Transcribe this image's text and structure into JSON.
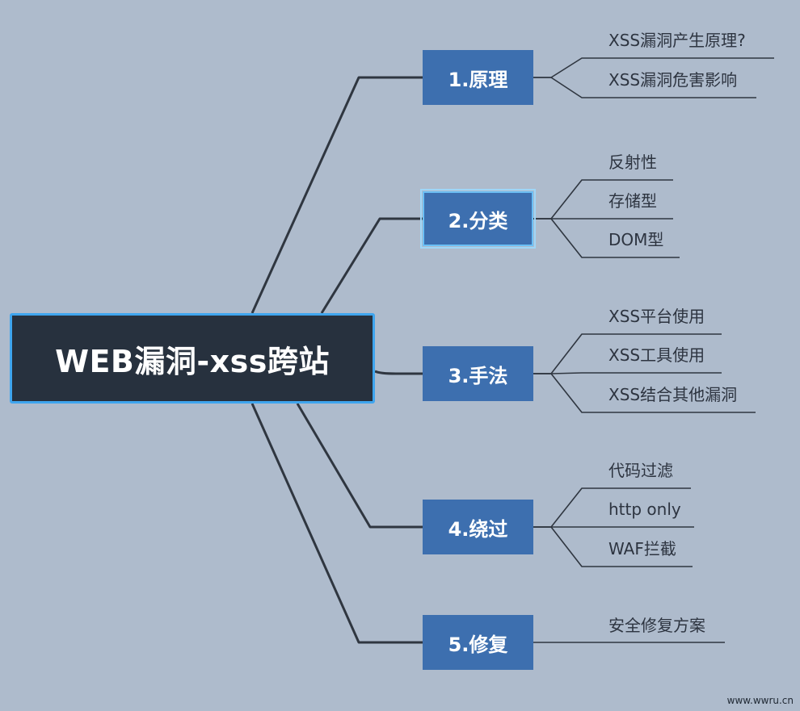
{
  "mindmap": {
    "root": "WEB漏洞-xss跨站",
    "branches": [
      {
        "label": "1.原理",
        "selected": false,
        "children": [
          "XSS漏洞产生原理?",
          "XSS漏洞危害影响"
        ]
      },
      {
        "label": "2.分类",
        "selected": true,
        "children": [
          "反射性",
          "存储型",
          "DOM型"
        ]
      },
      {
        "label": "3.手法",
        "selected": false,
        "children": [
          "XSS平台使用",
          "XSS工具使用",
          "XSS结合其他漏洞"
        ]
      },
      {
        "label": "4.绕过",
        "selected": false,
        "children": [
          "代码过滤",
          "http only",
          "WAF拦截"
        ]
      },
      {
        "label": "5.修复",
        "selected": false,
        "children": [
          "安全修复方案"
        ]
      }
    ]
  },
  "watermark": "www.wwru.cn",
  "colors": {
    "background": "#aebbcc",
    "root_fill": "#27313e",
    "root_border": "#3fa5ee",
    "branch_fill": "#3d6faf",
    "connector": "#2f3640",
    "leaf_text": "#2d3440"
  }
}
